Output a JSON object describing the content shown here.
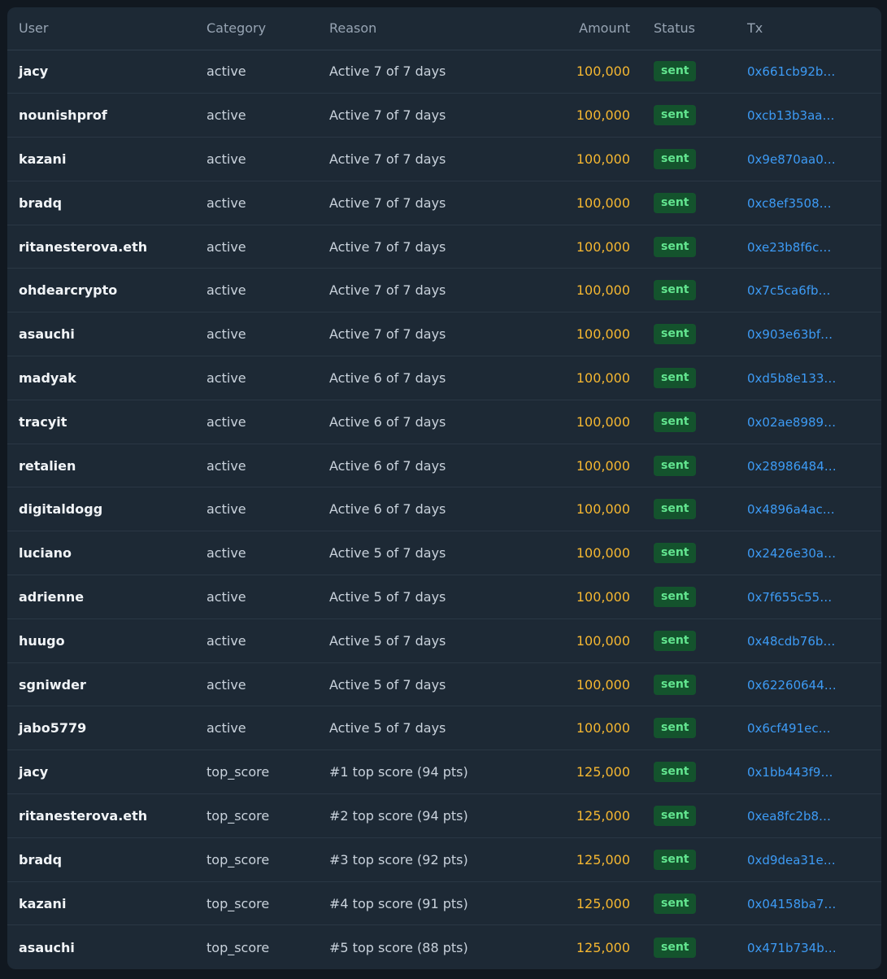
{
  "table": {
    "columns": [
      "User",
      "Category",
      "Reason",
      "Amount",
      "Status",
      "Tx"
    ],
    "rows": [
      {
        "user": "jacy",
        "category": "active",
        "reason": "Active 7 of 7 days",
        "amount": "100,000",
        "status": "sent",
        "tx": "0x661cb92b…"
      },
      {
        "user": "nounishprof",
        "category": "active",
        "reason": "Active 7 of 7 days",
        "amount": "100,000",
        "status": "sent",
        "tx": "0xcb13b3aa…"
      },
      {
        "user": "kazani",
        "category": "active",
        "reason": "Active 7 of 7 days",
        "amount": "100,000",
        "status": "sent",
        "tx": "0x9e870aa0…"
      },
      {
        "user": "bradq",
        "category": "active",
        "reason": "Active 7 of 7 days",
        "amount": "100,000",
        "status": "sent",
        "tx": "0xc8ef3508…"
      },
      {
        "user": "ritanesterova.eth",
        "category": "active",
        "reason": "Active 7 of 7 days",
        "amount": "100,000",
        "status": "sent",
        "tx": "0xe23b8f6c…"
      },
      {
        "user": "ohdearcrypto",
        "category": "active",
        "reason": "Active 7 of 7 days",
        "amount": "100,000",
        "status": "sent",
        "tx": "0x7c5ca6fb…"
      },
      {
        "user": "asauchi",
        "category": "active",
        "reason": "Active 7 of 7 days",
        "amount": "100,000",
        "status": "sent",
        "tx": "0x903e63bf…"
      },
      {
        "user": "madyak",
        "category": "active",
        "reason": "Active 6 of 7 days",
        "amount": "100,000",
        "status": "sent",
        "tx": "0xd5b8e133…"
      },
      {
        "user": "tracyit",
        "category": "active",
        "reason": "Active 6 of 7 days",
        "amount": "100,000",
        "status": "sent",
        "tx": "0x02ae8989…"
      },
      {
        "user": "retalien",
        "category": "active",
        "reason": "Active 6 of 7 days",
        "amount": "100,000",
        "status": "sent",
        "tx": "0x28986484…"
      },
      {
        "user": "digitaldogg",
        "category": "active",
        "reason": "Active 6 of 7 days",
        "amount": "100,000",
        "status": "sent",
        "tx": "0x4896a4ac…"
      },
      {
        "user": "luciano",
        "category": "active",
        "reason": "Active 5 of 7 days",
        "amount": "100,000",
        "status": "sent",
        "tx": "0x2426e30a…"
      },
      {
        "user": "adrienne",
        "category": "active",
        "reason": "Active 5 of 7 days",
        "amount": "100,000",
        "status": "sent",
        "tx": "0x7f655c55…"
      },
      {
        "user": "huugo",
        "category": "active",
        "reason": "Active 5 of 7 days",
        "amount": "100,000",
        "status": "sent",
        "tx": "0x48cdb76b…"
      },
      {
        "user": "sgniwder",
        "category": "active",
        "reason": "Active 5 of 7 days",
        "amount": "100,000",
        "status": "sent",
        "tx": "0x62260644…"
      },
      {
        "user": "jabo5779",
        "category": "active",
        "reason": "Active 5 of 7 days",
        "amount": "100,000",
        "status": "sent",
        "tx": "0x6cf491ec…"
      },
      {
        "user": "jacy",
        "category": "top_score",
        "reason": "#1 top score (94 pts)",
        "amount": "125,000",
        "status": "sent",
        "tx": "0x1bb443f9…"
      },
      {
        "user": "ritanesterova.eth",
        "category": "top_score",
        "reason": "#2 top score (94 pts)",
        "amount": "125,000",
        "status": "sent",
        "tx": "0xea8fc2b8…"
      },
      {
        "user": "bradq",
        "category": "top_score",
        "reason": "#3 top score (92 pts)",
        "amount": "125,000",
        "status": "sent",
        "tx": "0xd9dea31e…"
      },
      {
        "user": "kazani",
        "category": "top_score",
        "reason": "#4 top score (91 pts)",
        "amount": "125,000",
        "status": "sent",
        "tx": "0x04158ba7…"
      },
      {
        "user": "asauchi",
        "category": "top_score",
        "reason": "#5 top score (88 pts)",
        "amount": "125,000",
        "status": "sent",
        "tx": "0x471b734b…"
      }
    ]
  },
  "colors": {
    "amount": "#f5b731",
    "status_badge_bg": "#14532d",
    "status_badge_text": "#62e58f",
    "tx_link": "#3d9bf5",
    "panel_bg": "#1d2935"
  }
}
